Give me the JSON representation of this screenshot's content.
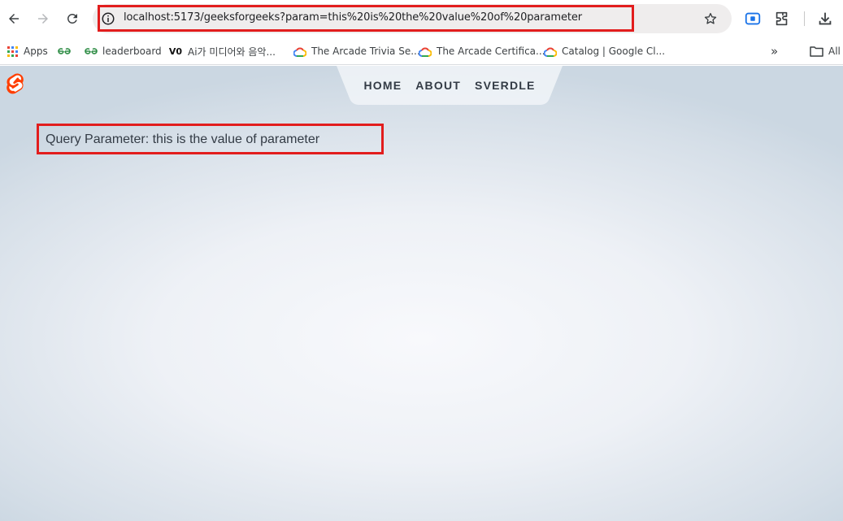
{
  "browser": {
    "url": "localhost:5173/geeksforgeeks?param=this%20is%20the%20value%20of%20parameter",
    "icons": [
      "back-arrow-icon",
      "forward-arrow-icon",
      "reload-icon",
      "info-icon",
      "star-icon",
      "screen-capture-icon",
      "extensions-icon",
      "download-icon"
    ]
  },
  "bookmarks": {
    "items": [
      {
        "label": "Apps",
        "icon": "apps-grid-icon"
      },
      {
        "label": "",
        "icon": "gfg-icon"
      },
      {
        "label": "leaderboard",
        "icon": "gfg-icon"
      },
      {
        "label": "Ai가 미디어와 음악...",
        "icon": "vo-icon"
      },
      {
        "label": "The Arcade Trivia Se...",
        "icon": "google-cloud-icon"
      },
      {
        "label": "The Arcade Certifica...",
        "icon": "google-cloud-icon"
      },
      {
        "label": "Catalog | Google Cl...",
        "icon": "google-cloud-icon"
      }
    ],
    "overflow_label": "»",
    "all_label": "All"
  },
  "site": {
    "nav": {
      "home": "HOME",
      "about": "ABOUT",
      "sverdle": "SVERDLE"
    },
    "query_text": "Query Parameter: this is the value of parameter"
  },
  "colors": {
    "highlight": "#e21d1d",
    "svelte_orange": "#ff3e00",
    "gfg_green": "#2f8d46"
  }
}
